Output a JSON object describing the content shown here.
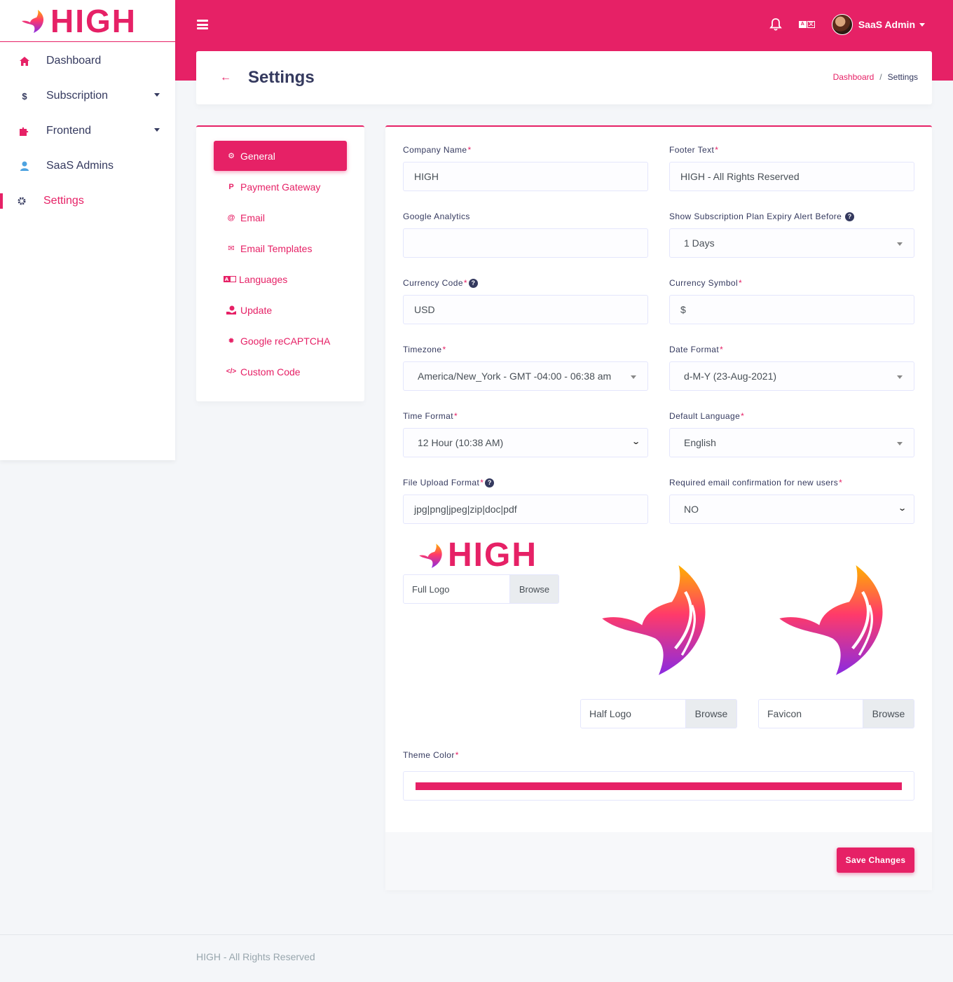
{
  "brand": {
    "name": "HIGH"
  },
  "sidebar": {
    "items": [
      {
        "label": "Dashboard",
        "icon": "home-icon"
      },
      {
        "label": "Subscription",
        "icon": "dollar-icon"
      },
      {
        "label": "Frontend",
        "icon": "puzzle-icon"
      },
      {
        "label": "SaaS Admins",
        "icon": "user-icon"
      },
      {
        "label": "Settings",
        "icon": "cog-icon"
      }
    ]
  },
  "topbar": {
    "user_name": "SaaS Admin"
  },
  "header": {
    "title": "Settings",
    "breadcrumb": {
      "link": "Dashboard",
      "separator": "/",
      "current": "Settings"
    }
  },
  "settings_menu": {
    "items": [
      {
        "label": "General",
        "icon": "cogs-icon"
      },
      {
        "label": "Payment Gateway",
        "icon": "paypal-icon"
      },
      {
        "label": "Email",
        "icon": "at-icon"
      },
      {
        "label": "Email Templates",
        "icon": "mail-bulk-icon"
      },
      {
        "label": "Languages",
        "icon": "language-icon"
      },
      {
        "label": "Update",
        "icon": "hand-holding-icon"
      },
      {
        "label": "Google reCAPTCHA",
        "icon": "certificate-icon"
      },
      {
        "label": "Custom Code",
        "icon": "code-icon"
      }
    ]
  },
  "form": {
    "company_name": {
      "label": "Company Name",
      "value": "HIGH"
    },
    "footer_text": {
      "label": "Footer Text",
      "value": "HIGH - All Rights Reserved"
    },
    "google_analytics": {
      "label": "Google Analytics",
      "value": ""
    },
    "expiry_alert": {
      "label": "Show Subscription Plan Expiry Alert Before",
      "value": "1 Days"
    },
    "currency_code": {
      "label": "Currency Code",
      "value": "USD"
    },
    "currency_symbol": {
      "label": "Currency Symbol",
      "value": "$"
    },
    "timezone": {
      "label": "Timezone",
      "value": "America/New_York - GMT -04:00 - 06:38 am"
    },
    "date_format": {
      "label": "Date Format",
      "value": "d-M-Y (23-Aug-2021)"
    },
    "time_format": {
      "label": "Time Format",
      "value": "12 Hour (10:38 AM)"
    },
    "default_language": {
      "label": "Default Language",
      "value": "English"
    },
    "file_upload_format": {
      "label": "File Upload Format",
      "value": "jpg|png|jpeg|zip|doc|pdf"
    },
    "email_confirmation": {
      "label": "Required email confirmation for new users",
      "value": "NO"
    },
    "full_logo": {
      "label": "Full Logo",
      "browse": "Browse",
      "logo_text": "HIGH"
    },
    "half_logo": {
      "label": "Half Logo",
      "browse": "Browse"
    },
    "favicon": {
      "label": "Favicon",
      "browse": "Browse"
    },
    "theme_color": {
      "label": "Theme Color",
      "value": "#e62166"
    },
    "save_label": "Save Changes",
    "required_mark": "*"
  },
  "footer": {
    "text": "HIGH - All Rights Reserved"
  },
  "colors": {
    "primary": "#e62166",
    "text": "#34395e",
    "background": "#f4f6f9"
  }
}
